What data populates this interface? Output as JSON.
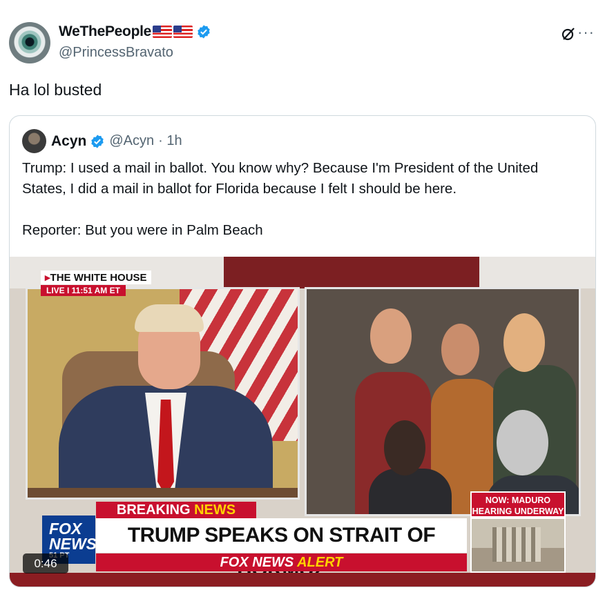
{
  "tweet": {
    "author": {
      "display_name": "WeThePeople",
      "handle": "@PrincessBravato",
      "verified": true,
      "flags": [
        "us-flag-icon",
        "us-flag-icon"
      ]
    },
    "text": "Ha lol busted",
    "actions": {
      "grok_icon": "grok-icon",
      "more_icon": "more-icon",
      "more_label": "···"
    }
  },
  "quote": {
    "author": {
      "display_name": "Acyn",
      "handle": "@Acyn",
      "time": "· 1h",
      "verified": true
    },
    "body": "Trump: I used a mail in ballot. You know why? Because I'm President of the United States, I did a mail in ballot for Florida because I felt I should be here.\n\nReporter: But you were in Palm Beach",
    "video": {
      "duration": "0:46",
      "overlay": {
        "location": "THE WHITE HOUSE",
        "live": "LIVE  I  11:51 AM ET",
        "breaking_prefix": "BREAKING",
        "breaking_suffix": "NEWS",
        "side_banner": "NOW: MADURO HEARING UNDERWAY",
        "headline": "TRUMP SPEAKS ON STRAIT OF HORMUZ",
        "alert_prefix": "FOX NEWS",
        "alert_suffix": "ALERT",
        "logo_top": "FOX",
        "logo_bottom": "NEWS",
        "logo_time": "51 PT"
      }
    }
  },
  "colors": {
    "verified": "#1d9bf0",
    "fox_red": "#c8102e",
    "fox_blue": "#0b3d91",
    "text_secondary": "#536471"
  }
}
